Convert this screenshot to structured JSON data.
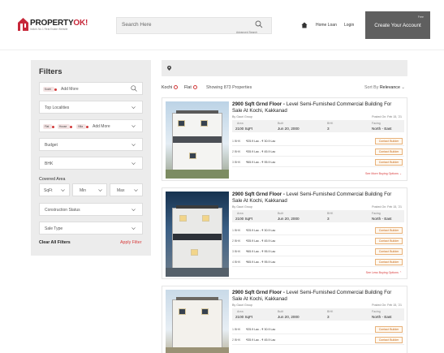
{
  "brand": {
    "name_main": "PROPERTY",
    "name_accent": "OK!",
    "tagline": "India's No.1 Real Estate Website",
    "logo_color": "#c7283a"
  },
  "header": {
    "search_placeholder": "Search Here",
    "advanced_search": "Advanced Search",
    "nav": [
      "Home Loan",
      "Login"
    ],
    "cta_free": "Free",
    "cta_label": "Create Your Account",
    "cta_color": "#5f5f5f"
  },
  "filters": {
    "title": "Filters",
    "location_chip": "Kochi",
    "add_more": "Add More",
    "top_localities": "Top Localities",
    "type_chips": [
      "Flat",
      "House",
      "Villa"
    ],
    "type_add_more": "Add More",
    "budget": "Budget",
    "bhk": "BHK",
    "covered_area_label": "Covered Area",
    "covered_area_unit": "SqFt",
    "covered_area_min": "Min",
    "covered_area_max": "Max",
    "construction_status": "Construction Status",
    "sale_type": "Sale Type",
    "clear_all": "Clear All Filters",
    "apply": "Apply Filter",
    "accent_color": "#d83b3b"
  },
  "results": {
    "active_tags": [
      "Kochi",
      "Flat"
    ],
    "showing": "Showing 873 Properties",
    "sort_label": "Sort By",
    "sort_value": "Relevance"
  },
  "listings": [
    {
      "title_bold": "2900 Sqft Grnd Floor -",
      "title_rest": " Level Semi-Furnished Commercial Building For Sale At Kochi, Kakkanad",
      "by": "By Gauri Group",
      "posted": "Posted On: Feb 15, '21",
      "spec_keys": [
        "Area",
        "Built",
        "BHK",
        "Facing"
      ],
      "spec_values": [
        "2100 SqFt",
        "Jun 20, 2000",
        "3",
        "North - East"
      ],
      "rows": [
        {
          "bhk": "1 BHK",
          "price": "₹25.9 Lac - ₹ 30.9 Lac"
        },
        {
          "bhk": "2 BHK",
          "price": "₹35.9 Lac - ₹ 45.9 Lac"
        },
        {
          "bhk": "3 BHK",
          "price": "₹65.9 Lac - ₹ 95.9 Lac"
        }
      ],
      "contact_label": "Contact Builder",
      "more_label": "See More Buying Options ⌄"
    },
    {
      "title_bold": "2900 Sqft Grnd Floor -",
      "title_rest": " Level Semi-Furnished Commercial Building For Sale At Kochi, Kakkanad",
      "by": "By Gauri Group",
      "posted": "Posted On: Feb 15, '21",
      "spec_keys": [
        "Area",
        "Built",
        "BHK",
        "Facing"
      ],
      "spec_values": [
        "2100 SqFt",
        "Jun 20, 2000",
        "3",
        "North - East"
      ],
      "rows": [
        {
          "bhk": "1 BHK",
          "price": "₹25.9 Lac - ₹ 30.9 Lac"
        },
        {
          "bhk": "2 BHK",
          "price": "₹35.9 Lac - ₹ 45.9 Lac"
        },
        {
          "bhk": "3 BHK",
          "price": "₹65.9 Lac - ₹ 95.9 Lac"
        },
        {
          "bhk": "4 BHK",
          "price": "₹65.9 Lac - ₹ 95.9 Lac"
        }
      ],
      "contact_label": "Contact Builder",
      "more_label": "See Less Buying Options ⌃"
    },
    {
      "title_bold": "2900 Sqft Grnd Floor -",
      "title_rest": " Level Semi-Furnished Commercial Building For Sale At Kochi, Kakkanad",
      "by": "By Gauri Group",
      "posted": "Posted On: Feb 15, '21",
      "spec_keys": [
        "Area",
        "Built",
        "BHK",
        "Facing"
      ],
      "spec_values": [
        "2100 SqFt",
        "Jun 20, 2000",
        "3",
        "North - East"
      ],
      "rows": [
        {
          "bhk": "1 BHK",
          "price": "₹25.9 Lac - ₹ 30.9 Lac"
        },
        {
          "bhk": "2 BHK",
          "price": "₹35.9 Lac - ₹ 45.9 Lac"
        }
      ],
      "contact_label": "Contact Builder",
      "more_label": ""
    }
  ]
}
